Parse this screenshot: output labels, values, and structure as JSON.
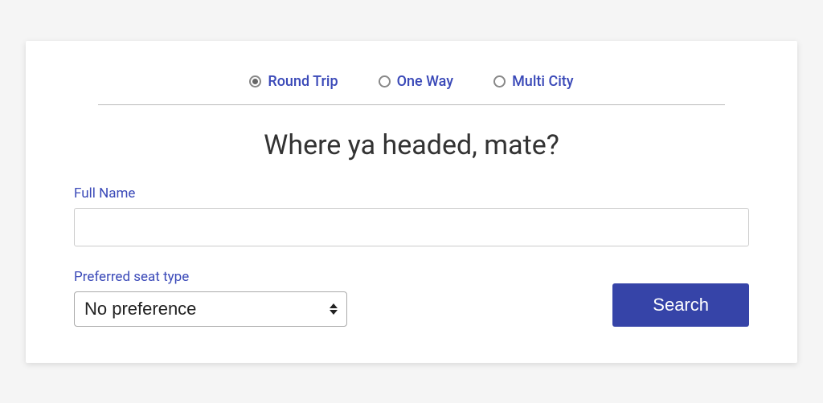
{
  "trip_types": {
    "round_trip": "Round Trip",
    "one_way": "One Way",
    "multi_city": "Multi City",
    "selected": "round_trip"
  },
  "heading": "Where ya headed, mate?",
  "full_name": {
    "label": "Full Name",
    "value": ""
  },
  "seat_type": {
    "label": "Preferred seat type",
    "selected": "No preference"
  },
  "search_button": "Search"
}
